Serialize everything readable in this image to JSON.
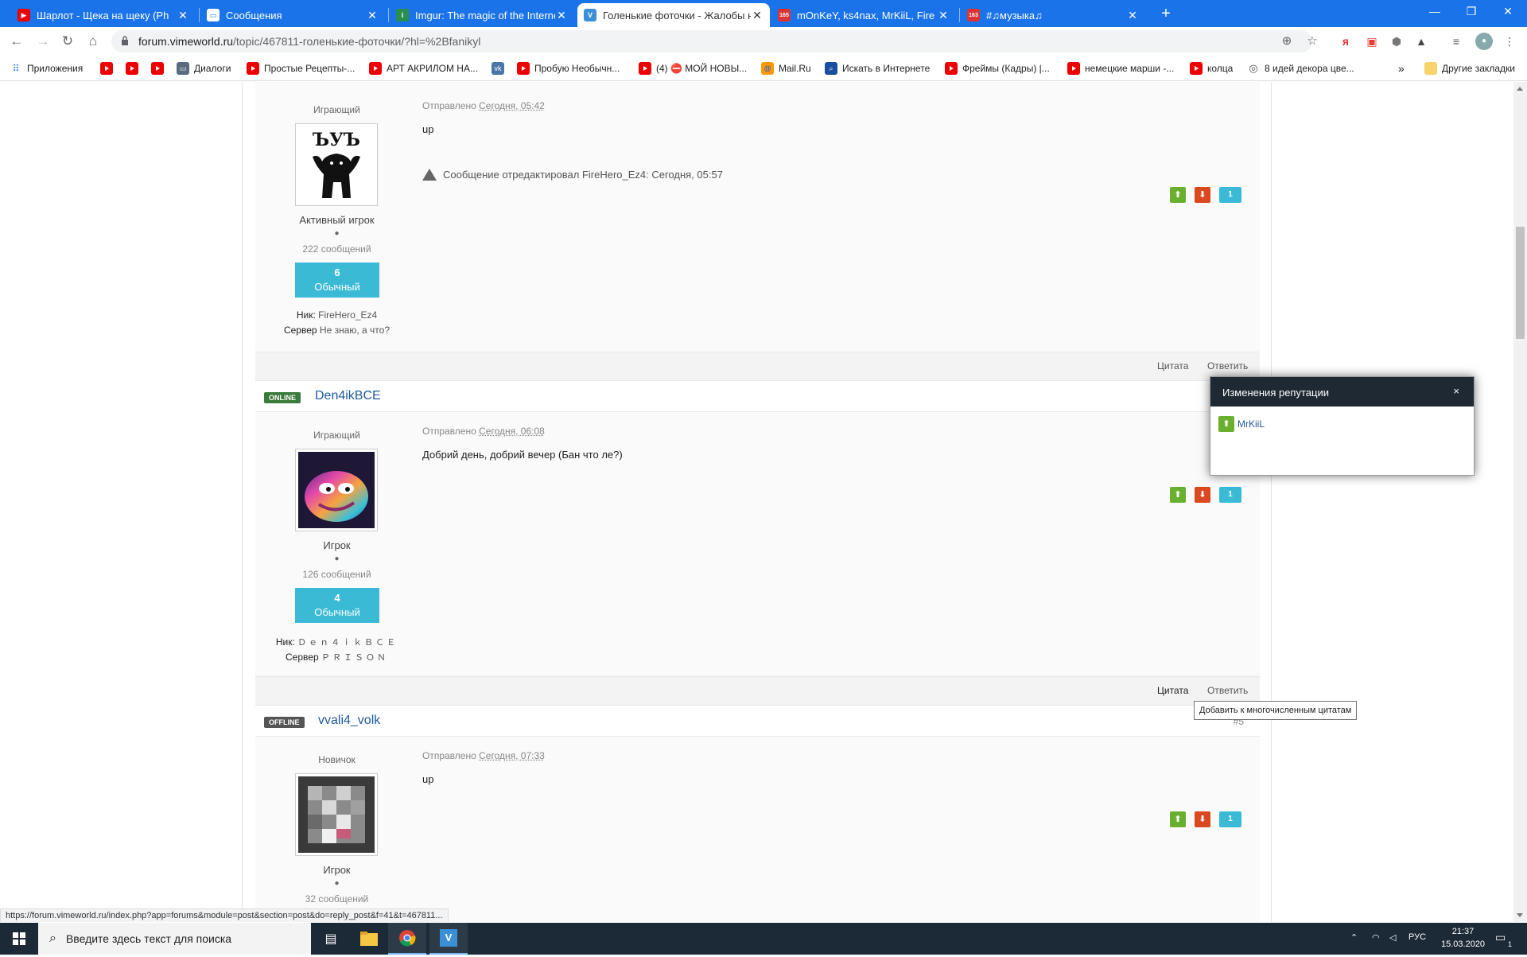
{
  "browser": {
    "tabs": [
      {
        "title": "Шарлот - Щека на щеку (Ph",
        "favicon": "youtube"
      },
      {
        "title": "Сообщения",
        "favicon": "chat"
      },
      {
        "title": "Imgur: The magic of the Internet",
        "favicon": "imgur"
      },
      {
        "title": "Голенькие фоточки - Жалобы н",
        "favicon": "vimeworld"
      },
      {
        "title": "mOnKeY, ks4nax, MrKiiL, Fire",
        "favicon": "vk-165"
      },
      {
        "title": "#♫музыка♫",
        "favicon": "vk-163"
      }
    ],
    "tab_badges": {
      "tab5": "165",
      "tab6": "163"
    },
    "url_host": "forum.vimeworld.ru",
    "url_path": "/topic/467811-голенькие-фоточки/?hl=%2Bfanikyl",
    "bookmarks": [
      "Приложения",
      "",
      "",
      "",
      "Диалоги",
      "Простые Рецепты-...",
      "АРТ АКРИЛОМ НА...",
      "",
      "Пробую Необычн...",
      "(4) ⛔ МОЙ НОВЫ...",
      "Mail.Ru",
      "Искать в Интернете",
      "Фреймы (Кадры) |...",
      "немецкие марши -...",
      "колца",
      "8 идей декора цве...",
      "»",
      "Другие закладки"
    ],
    "status_url": "https://forum.vimeworld.ru/index.php?app=forums&module=post&section=post&do=reply_post&f=41&t=467811..."
  },
  "posts": [
    {
      "group": "Играющий",
      "rank": "Активный игрок",
      "dot": "●",
      "post_count": "222 сообщений",
      "rep_value": "6",
      "rep_label": "Обычный",
      "nick_label": "Ник:",
      "nick_value": "FireHero_Ez4",
      "server_label": "Сервер",
      "server_value": "Не знаю, а что?",
      "posted_label": "Отправлено",
      "posted_time": "Сегодня, 05:42",
      "body": "up",
      "edited": "Сообщение отредактировал FireHero_Ez4: Сегодня, 05:57",
      "rep_count": "1",
      "quote": "Цитата",
      "reply": "Ответить"
    },
    {
      "status": "ONLINE",
      "author": "Den4ikBCE",
      "group": "Играющий",
      "rank": "Игрок",
      "dot": "●",
      "post_count": "126 сообщений",
      "rep_value": "4",
      "rep_label": "Обычный",
      "nick_label": "Ник:",
      "nick_value": "Ｄｅｎ４ｉｋＢＣＥ",
      "server_label": "Сервер",
      "server_value": "ＰＲＩＳＯＮ",
      "posted_label": "Отправлено",
      "posted_time": "Сегодня, 06:08",
      "body": "Добрий день, добрий вечер (Бан что ле?)",
      "rep_count": "1",
      "quote": "Цитата",
      "reply": "Ответить"
    },
    {
      "status": "OFFLINE",
      "author": "vvali4_volk",
      "post_num": "#5",
      "group": "Новичок",
      "rank": "Игрок",
      "dot": "●",
      "post_count": "32 сообщений",
      "posted_label": "Отправлено",
      "posted_time": "Сегодня, 07:33",
      "body": "up",
      "rep_count": "1"
    }
  ],
  "rep_popup": {
    "title": "Изменения репутации",
    "close": "×",
    "user": "MrKiiL"
  },
  "tooltip": "Добавить к многочисленным цитатам",
  "taskbar": {
    "search_placeholder": "Введите здесь текст для поиска",
    "lang": "РУС",
    "time": "21:37",
    "date": "15.03.2020",
    "notif": "1"
  },
  "colors": {
    "chrome_blue": "#1a73e8",
    "rep_up": "#6ab02e",
    "rep_down": "#d9481e",
    "rep_box": "#3bbad6",
    "online": "#3a7a3a",
    "author_link": "#1c5a9c"
  }
}
